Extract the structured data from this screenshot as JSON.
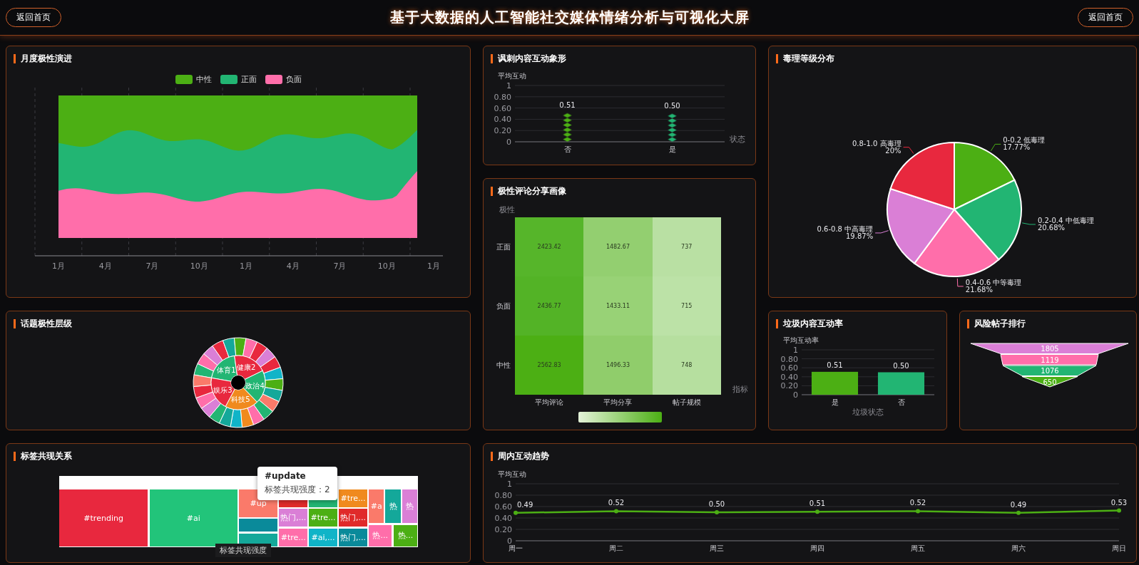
{
  "header": {
    "title": "基于大数据的人工智能社交媒体情绪分析与可视化大屏",
    "buttons": [
      "返回首页",
      "返回首页"
    ]
  },
  "monthly_polarity": {
    "title": "月度极性演进",
    "legend": [
      {
        "label": "中性",
        "color": "#4caf14"
      },
      {
        "label": "正面",
        "color": "#22b573"
      },
      {
        "label": "负面",
        "color": "#ff6eaa"
      }
    ],
    "x_labels": [
      "1月",
      "4月",
      "7月",
      "10月",
      "1月",
      "4月",
      "7月",
      "10月",
      "1月"
    ]
  },
  "sarcasm_pictograph": {
    "title": "讽刺内容互动象形",
    "chart_data": {
      "type": "bar",
      "ylabel": "平均互动",
      "xlabel": "状态",
      "categories": [
        "否",
        "是"
      ],
      "values": [
        0.51,
        0.5
      ],
      "ylim": [
        0,
        1
      ],
      "yticks": [
        0,
        {
          "value": 0.2,
          "label": "0.20"
        },
        {
          "value": 0.4,
          "label": "0.40"
        },
        {
          "value": 0.6,
          "label": "0.60"
        },
        {
          "value": 0.8,
          "label": "0.80"
        },
        1
      ],
      "grid": true,
      "value_labels": [
        "0.51",
        "0.50"
      ]
    }
  },
  "toxicity_distribution": {
    "title": "毒理等级分布",
    "chart_data": {
      "type": "pie",
      "categories": [
        "0-0.2 低毒理",
        "0.2-0.4 中低毒理",
        "0.4-0.6 中等毒理",
        "0.6-0.8 中高毒理",
        "0.8-1.0 高毒理"
      ],
      "values": [
        17.77,
        20.68,
        21.68,
        19.87,
        20
      ],
      "value_labels": [
        "17.77%",
        "20.68%",
        "21.68%",
        "19.87%",
        "20%"
      ]
    }
  },
  "polarity_heatmap": {
    "title": "极性评论分享画像",
    "y_name": "极性",
    "x_name": "指标",
    "x_labels": [
      "平均评论",
      "平均分享",
      "帖子规模"
    ],
    "rows": [
      {
        "label": "正面",
        "cells": [
          {
            "text": "2423.42",
            "color": "#56b52a"
          },
          {
            "text": "1482.67",
            "color": "#93cf70"
          },
          {
            "text": "737",
            "color": "#b9e0a3"
          }
        ]
      },
      {
        "label": "负面",
        "cells": [
          {
            "text": "2436.77",
            "color": "#53b326"
          },
          {
            "text": "1433.11",
            "color": "#98d276"
          },
          {
            "text": "715",
            "color": "#bce2a7"
          }
        ]
      },
      {
        "label": "中性",
        "cells": [
          {
            "text": "2562.83",
            "color": "#4caf14"
          },
          {
            "text": "1496.33",
            "color": "#90cd6b"
          },
          {
            "text": "748",
            "color": "#b6df9f"
          }
        ]
      }
    ]
  },
  "topic_hierarchy": {
    "title": "话题极性层级",
    "inner": [
      {
        "label": "体育1",
        "color": "#22b573"
      },
      {
        "label": "健康2",
        "color": "#e8283e"
      },
      {
        "label": "政治4",
        "color": "#22b573"
      },
      {
        "label": "科技5",
        "color": "#f08a1e"
      },
      {
        "label": "娱乐3",
        "color": "#e8283e"
      }
    ],
    "outer": [
      {
        "color": "#22b573"
      },
      {
        "color": "#ff6eaa"
      },
      {
        "color": "#da7fd6"
      },
      {
        "color": "#e8283e"
      },
      {
        "color": "#14a89a"
      },
      {
        "color": "#4caf14"
      },
      {
        "color": "#ff6eaa"
      },
      {
        "color": "#e8283e"
      },
      {
        "color": "#da7fd6"
      },
      {
        "color": "#e8283e"
      },
      {
        "color": "#10b4c8"
      },
      {
        "color": "#4caf14"
      },
      {
        "color": "#14a89a"
      },
      {
        "color": "#fa7a6a"
      },
      {
        "color": "#22b573"
      },
      {
        "color": "#ff6eaa"
      },
      {
        "color": "#f08a1e"
      },
      {
        "color": "#10b4c8"
      },
      {
        "color": "#14a89a"
      },
      {
        "color": "#22b573"
      },
      {
        "color": "#da7fd6"
      },
      {
        "color": "#ff6eaa"
      },
      {
        "color": "#e8283e"
      },
      {
        "color": "#fa7a6a"
      }
    ]
  },
  "spam_interaction": {
    "title": "垃圾内容互动率",
    "chart_data": {
      "type": "bar",
      "ylabel": "平均互动率",
      "xlabel": "垃圾状态",
      "categories": [
        "是",
        "否"
      ],
      "values": [
        0.51,
        0.5
      ],
      "ylim": [
        0,
        1
      ],
      "yticks": [
        0,
        {
          "value": 0.2,
          "label": "0.20"
        },
        {
          "value": 0.4,
          "label": "0.40"
        },
        {
          "value": 0.6,
          "label": "0.60"
        },
        {
          "value": 0.8,
          "label": "0.80"
        },
        1
      ],
      "grid": true,
      "value_labels": [
        "0.51",
        "0.50"
      ]
    }
  },
  "risk_ranking": {
    "title": "风险帖子排行",
    "items": [
      {
        "value": "1805",
        "color": "#da7fd6"
      },
      {
        "value": "1119",
        "color": "#ff6eaa"
      },
      {
        "value": "1076",
        "color": "#22b573"
      },
      {
        "value": "650",
        "color": "#4caf14"
      }
    ]
  },
  "tag_cooccurrence": {
    "title": "标签共现关系",
    "cells": [
      {
        "label": "#trending",
        "color": "#e8283e"
      },
      {
        "label": "#ai",
        "color": "#22c47a"
      },
      {
        "label": "#up",
        "color": "#fa7a6a"
      },
      {
        "color": "#0a8a9a"
      },
      {
        "color": "#14a89a"
      },
      {
        "color": "#e02a2a"
      },
      {
        "color": "#22b573"
      },
      {
        "label": "热门,...",
        "color": "#da7fd6"
      },
      {
        "label": "#tre...",
        "color": "#ff6eaa"
      },
      {
        "label": "#tre...",
        "color": "#4caf14"
      },
      {
        "label": "#ai,...",
        "color": "#10b4c8"
      },
      {
        "label": "#tre...",
        "color": "#f08a1e"
      },
      {
        "label": "热门,...",
        "color": "#e02a2a"
      },
      {
        "label": "热门,...",
        "color": "#0a8a9a"
      },
      {
        "label": "#a",
        "color": "#fa7a6a"
      },
      {
        "label": "热",
        "color": "#14a89a"
      },
      {
        "label": "热",
        "color": "#da7fd6"
      },
      {
        "label": "热...",
        "color": "#ff6eaa"
      },
      {
        "label": "热...",
        "color": "#4caf14"
      }
    ],
    "tooltip": {
      "title": "#update",
      "text": "标签共现强度：2"
    },
    "scale_label": "标签共现强度"
  },
  "weekly_trend": {
    "title": "周内互动趋势",
    "chart_data": {
      "type": "line",
      "ylabel": "平均互动",
      "categories": [
        "周一",
        "周二",
        "周三",
        "周四",
        "周五",
        "周六",
        "周日"
      ],
      "values": [
        0.49,
        0.52,
        0.5,
        0.51,
        0.52,
        0.49,
        0.53
      ],
      "ylim": [
        0,
        1
      ],
      "yticks": [
        0,
        {
          "value": 0.2,
          "label": "0.20"
        },
        {
          "value": 0.4,
          "label": "0.40"
        },
        {
          "value": 0.6,
          "label": "0.60"
        },
        {
          "value": 0.8,
          "label": "0.80"
        },
        1
      ],
      "grid": true,
      "marker": true,
      "value_labels": [
        "0.49",
        "0.52",
        "0.50",
        "0.51",
        "0.52",
        "0.49",
        "0.53"
      ]
    }
  }
}
